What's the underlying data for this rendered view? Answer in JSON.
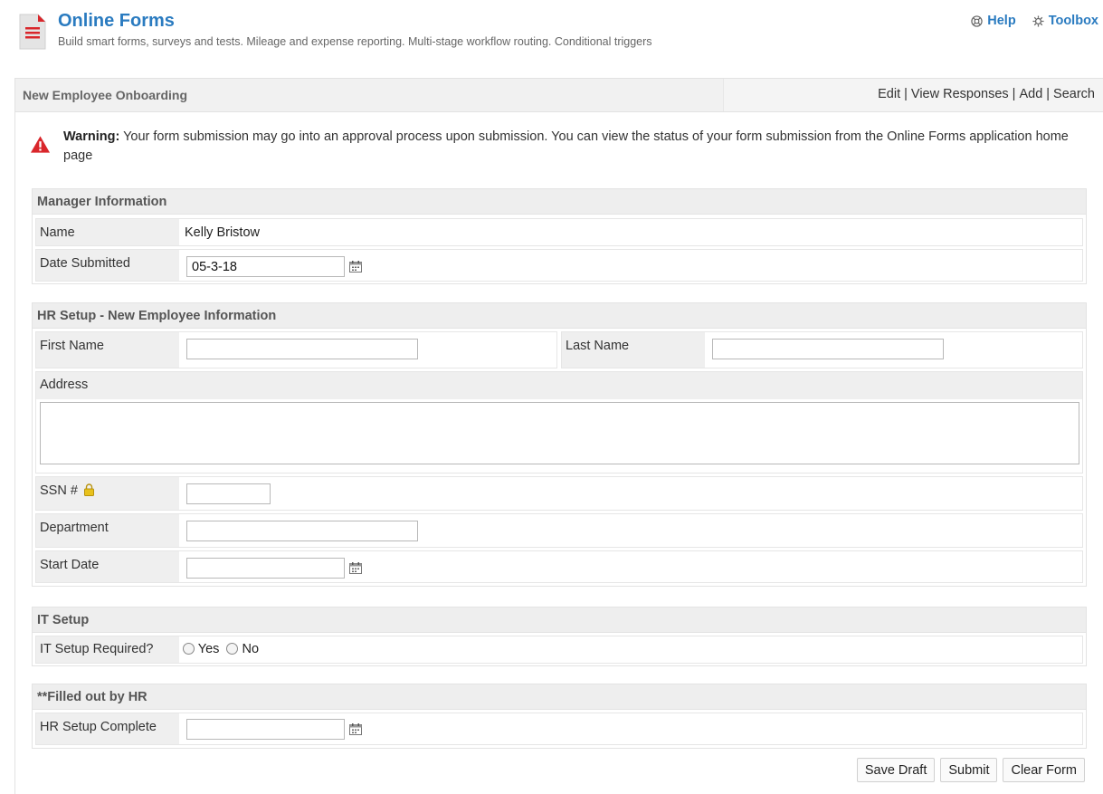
{
  "app": {
    "title": "Online Forms",
    "subtitle": "Build smart forms, surveys and tests. Mileage and expense reporting. Multi-stage workflow routing. Conditional triggers",
    "help_label": "Help",
    "toolbox_label": "Toolbox"
  },
  "panel": {
    "title": "New Employee Onboarding",
    "actions": {
      "edit": "Edit",
      "view_responses": "View Responses",
      "add": "Add",
      "search": "Search",
      "separator": "|"
    }
  },
  "warning": {
    "label": "Warning:",
    "text": " Your form submission may go into an approval process upon submission. You can view the status of your form submission from the Online Forms application home page"
  },
  "manager_section": {
    "title": "Manager Information",
    "name_label": "Name",
    "name_value": "Kelly Bristow",
    "date_label": "Date Submitted",
    "date_value": "05-3-18"
  },
  "hr_section": {
    "title": "HR Setup - New Employee Information",
    "first_name_label": "First Name",
    "first_name_value": "",
    "last_name_label": "Last Name",
    "last_name_value": "",
    "address_label": "Address",
    "address_value": "",
    "ssn_label": "SSN #",
    "ssn_value": "",
    "department_label": "Department",
    "department_value": "",
    "start_date_label": "Start Date",
    "start_date_value": ""
  },
  "it_section": {
    "title": "IT Setup",
    "required_label": "IT Setup Required?",
    "yes_label": "Yes",
    "no_label": "No"
  },
  "hr_fill_section": {
    "title": "**Filled out by HR",
    "complete_label": "HR Setup Complete",
    "complete_value": ""
  },
  "buttons": {
    "save_draft": "Save Draft",
    "submit": "Submit",
    "clear_form": "Clear Form"
  },
  "colors": {
    "accent": "#2a7bc0",
    "warning": "#d9262b",
    "header_bg": "#f1f1f1"
  }
}
